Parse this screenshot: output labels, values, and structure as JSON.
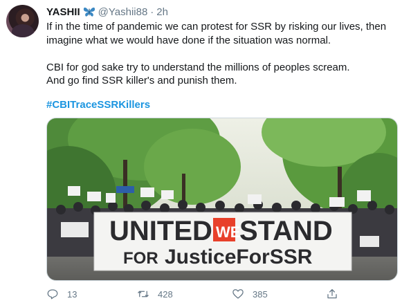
{
  "tweet": {
    "display_name": "YASHII",
    "name_emoji_icon": "butterfly-icon",
    "handle": "@Yashii88",
    "separator": "·",
    "time": "2h",
    "lines": [
      "If in the time of pandemic we can protest for SSR by risking our lives, then",
      "imagine what we would have done if the situation was normal.",
      "CBI for god sake try to understand the millions of peoples scream.",
      "And go find SSR killer's and punish them."
    ],
    "hashtag": "#CBITraceSSRKillers"
  },
  "media": {
    "banner_line1_left": "UNITED",
    "banner_we": "WE",
    "banner_line1_right": "STAND",
    "banner_line2_left": "FOR",
    "banner_line2_right": "JusticeForSSR"
  },
  "actions": {
    "reply_icon": "reply-icon",
    "reply_count": "13",
    "retweet_icon": "retweet-icon",
    "retweet_count": "428",
    "like_icon": "heart-icon",
    "like_count": "385",
    "share_icon": "share-icon"
  },
  "colors": {
    "link": "#1b95e0",
    "secondary_text": "#657786",
    "banner_accent": "#e8402a"
  }
}
